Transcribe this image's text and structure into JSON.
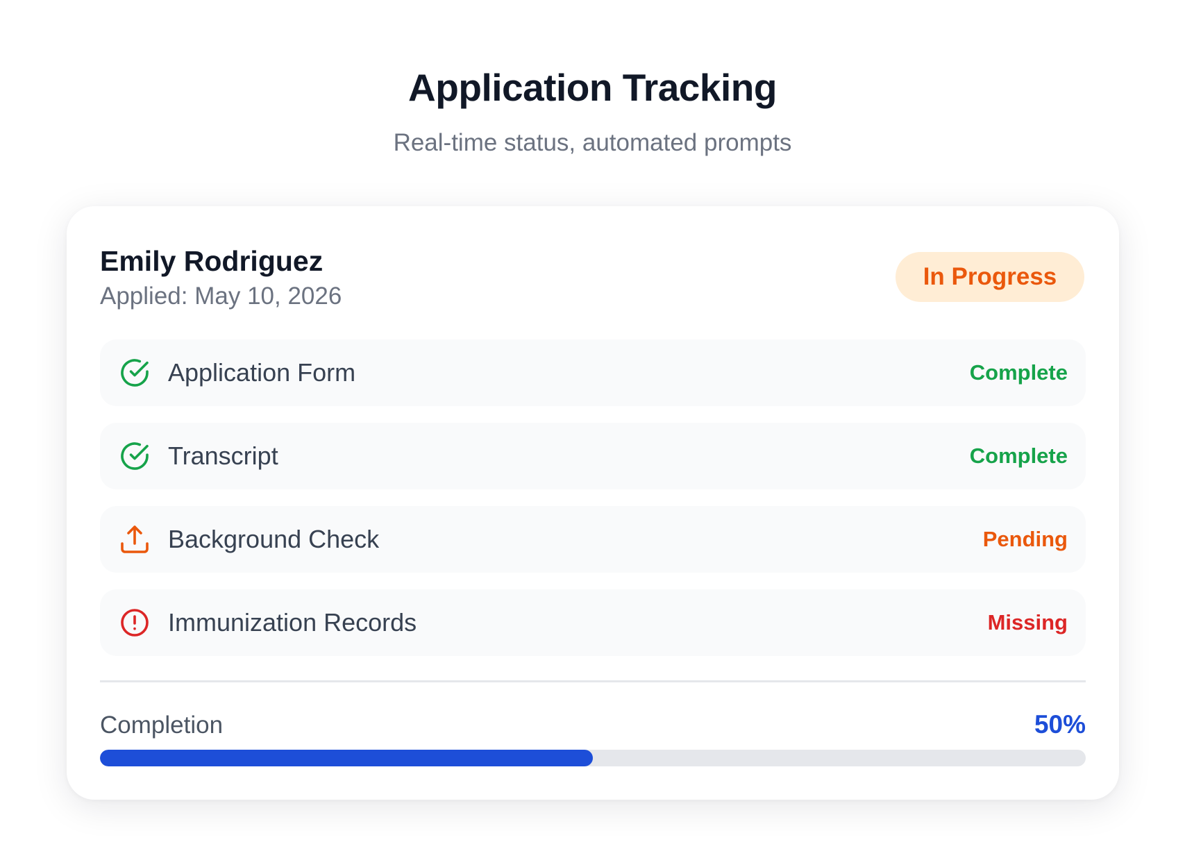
{
  "header": {
    "title": "Application Tracking",
    "subtitle": "Real-time status, automated prompts"
  },
  "applicant": {
    "name": "Emily Rodriguez",
    "applied_label": "Applied:",
    "applied_date": "May 10, 2026",
    "status": "In Progress"
  },
  "items": [
    {
      "label": "Application Form",
      "status": "Complete",
      "icon": "check-circle-icon",
      "color": "#16a34a"
    },
    {
      "label": "Transcript",
      "status": "Complete",
      "icon": "check-circle-icon",
      "color": "#16a34a"
    },
    {
      "label": "Background Check",
      "status": "Pending",
      "icon": "upload-icon",
      "color": "#ea580c"
    },
    {
      "label": "Immunization Records",
      "status": "Missing",
      "icon": "alert-circle-icon",
      "color": "#dc2626"
    }
  ],
  "completion": {
    "label": "Completion",
    "value_text": "50%",
    "fraction": 0.5
  },
  "colors": {
    "accent": "#1d4ed8",
    "complete": "#16a34a",
    "pending": "#ea580c",
    "missing": "#dc2626",
    "pill_bg": "#ffedd5"
  }
}
